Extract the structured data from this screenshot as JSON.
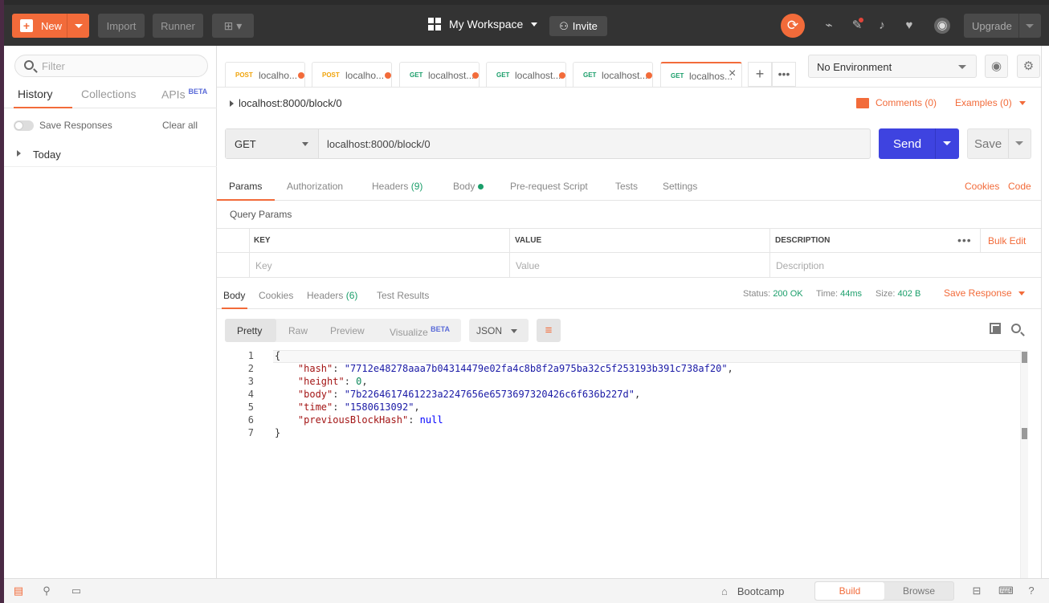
{
  "topbar": {
    "new_label": "New",
    "import_label": "Import",
    "runner_label": "Runner",
    "workspace_label": "My Workspace",
    "invite_label": "Invite",
    "upgrade_label": "Upgrade"
  },
  "sidebar": {
    "filter_placeholder": "Filter",
    "tabs": [
      {
        "label": "History"
      },
      {
        "label": "Collections"
      },
      {
        "label": "APIs",
        "badge": "BETA"
      }
    ],
    "save_responses_label": "Save Responses",
    "clear_all_label": "Clear all",
    "groups": [
      {
        "label": "Today"
      }
    ]
  },
  "request_tabs": [
    {
      "method": "POST",
      "label": "localho..."
    },
    {
      "method": "POST",
      "label": "localho..."
    },
    {
      "method": "GET",
      "label": "localhost..."
    },
    {
      "method": "GET",
      "label": "localhost..."
    },
    {
      "method": "GET",
      "label": "localhost..."
    },
    {
      "method": "GET",
      "label": "localhos..."
    }
  ],
  "environment": {
    "selected": "No Environment"
  },
  "request": {
    "title": "localhost:8000/block/0",
    "comments_label": "Comments (0)",
    "examples_label": "Examples (0)",
    "method": "GET",
    "url": "localhost:8000/block/0",
    "send_label": "Send",
    "save_label": "Save"
  },
  "request_subtabs": {
    "params": "Params",
    "authorization": "Authorization",
    "headers": "Headers",
    "headers_count": "(9)",
    "body": "Body",
    "prerequest": "Pre-request Script",
    "tests": "Tests",
    "settings": "Settings",
    "cookies": "Cookies",
    "code": "Code"
  },
  "query_params": {
    "section_label": "Query Params",
    "headers": {
      "key": "KEY",
      "value": "VALUE",
      "description": "DESCRIPTION"
    },
    "placeholders": {
      "key": "Key",
      "value": "Value",
      "description": "Description"
    },
    "bulk_edit_label": "Bulk Edit"
  },
  "response": {
    "tabs": {
      "body": "Body",
      "cookies": "Cookies",
      "headers": "Headers",
      "headers_count": "(6)",
      "test_results": "Test Results"
    },
    "status_label": "Status:",
    "status_value": "200 OK",
    "time_label": "Time:",
    "time_value": "44ms",
    "size_label": "Size:",
    "size_value": "402 B",
    "save_response_label": "Save Response",
    "formats": {
      "pretty": "Pretty",
      "raw": "Raw",
      "preview": "Preview",
      "visualize": "Visualize",
      "visualize_badge": "BETA"
    },
    "language": "JSON",
    "body_lines": {
      "l1": {
        "num": "1",
        "text": "{"
      },
      "l2": {
        "num": "2",
        "key": "\"hash\"",
        "value": "\"7712e48278aaa7b04314479e02fa4c8b8f2a975ba32c5f253193b391c738af20\"",
        "suffix": ","
      },
      "l3": {
        "num": "3",
        "key": "\"height\"",
        "value": "0",
        "suffix": ","
      },
      "l4": {
        "num": "4",
        "key": "\"body\"",
        "value": "\"7b2264617461223a2247656e6573697320426c6f636b227d\"",
        "suffix": ","
      },
      "l5": {
        "num": "5",
        "key": "\"time\"",
        "value": "\"1580613092\"",
        "suffix": ","
      },
      "l6": {
        "num": "6",
        "key": "\"previousBlockHash\"",
        "value": "null",
        "suffix": ""
      },
      "l7": {
        "num": "7",
        "text": "}"
      }
    }
  },
  "footer": {
    "bootcamp_label": "Bootcamp",
    "build_label": "Build",
    "browse_label": "Browse"
  },
  "colors": {
    "accent": "#f26b3a",
    "send": "#3e43e0",
    "get_method": "#1a9e6a",
    "post_method": "#f0a30a"
  }
}
